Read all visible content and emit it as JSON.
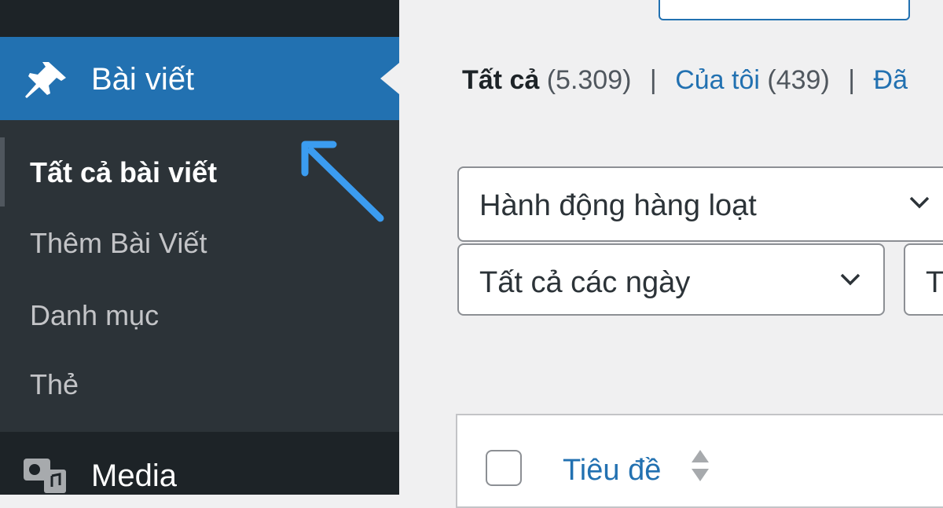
{
  "sidebar": {
    "posts_label": "Bài viết",
    "submenu": [
      {
        "label": "Tất cả bài viết",
        "current": true
      },
      {
        "label": "Thêm Bài Viết"
      },
      {
        "label": "Danh mục"
      },
      {
        "label": "Thẻ"
      }
    ],
    "media_label": "Media"
  },
  "filters": {
    "all_label": "Tất cả",
    "all_count": "(5.309)",
    "mine_label": "Của tôi",
    "mine_count": "(439)",
    "published_partial": "Đã"
  },
  "bulk_actions": {
    "selected": "Hành động hàng loạt"
  },
  "date_filter": {
    "selected": "Tất cả các ngày"
  },
  "category_filter": {
    "selected_partial": "T"
  },
  "table": {
    "title_column": "Tiêu đề"
  },
  "colors": {
    "sidebar_bg": "#2c3338",
    "sidebar_dark": "#1d2327",
    "accent": "#2271b1",
    "content_bg": "#f0f0f1",
    "arrow": "#3b9cf0"
  },
  "icons": {
    "posts": "pushpin-icon",
    "media": "media-icon",
    "chevron": "chevron-down-icon",
    "sort": "sort-icon"
  }
}
